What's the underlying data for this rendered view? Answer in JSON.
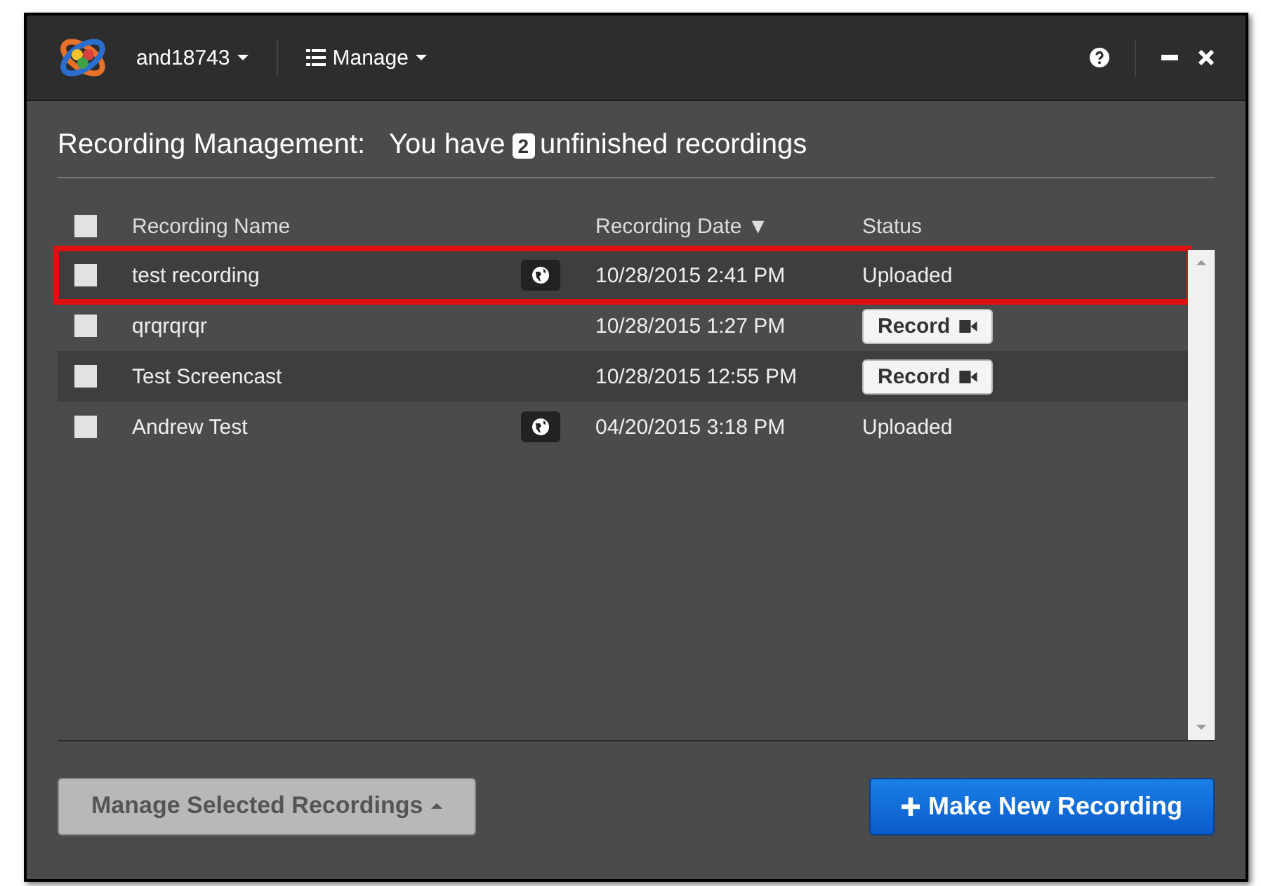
{
  "titlebar": {
    "user_menu": "and18743",
    "manage_menu": "Manage"
  },
  "heading": {
    "title": "Recording Management:",
    "prefix": "You have",
    "count": "2",
    "suffix": "unfinished recordings"
  },
  "table": {
    "select_all": {
      "checked": false
    },
    "columns": [
      {
        "label": "Recording Name"
      },
      {
        "label": "Recording Date",
        "sort": "▼"
      },
      {
        "label": "Status"
      }
    ],
    "rows": [
      {
        "checked": false,
        "highlighted": true,
        "name": "test recording",
        "shared": true,
        "date": "10/28/2015 2:41 PM",
        "status": {
          "kind": "text",
          "label": "Uploaded"
        }
      },
      {
        "checked": false,
        "highlighted": false,
        "name": "qrqrqrqr",
        "shared": false,
        "date": "10/28/2015 1:27 PM",
        "status": {
          "kind": "button",
          "label": "Record"
        }
      },
      {
        "checked": false,
        "highlighted": false,
        "name": "Test Screencast",
        "shared": false,
        "date": "10/28/2015 12:55 PM",
        "status": {
          "kind": "button",
          "label": "Record"
        }
      },
      {
        "checked": false,
        "highlighted": false,
        "name": "Andrew Test",
        "shared": true,
        "date": "04/20/2015 3:18 PM",
        "status": {
          "kind": "text",
          "label": "Uploaded"
        }
      }
    ]
  },
  "footer": {
    "manage_button": "Manage Selected Recordings",
    "new_button": "Make New Recording"
  }
}
